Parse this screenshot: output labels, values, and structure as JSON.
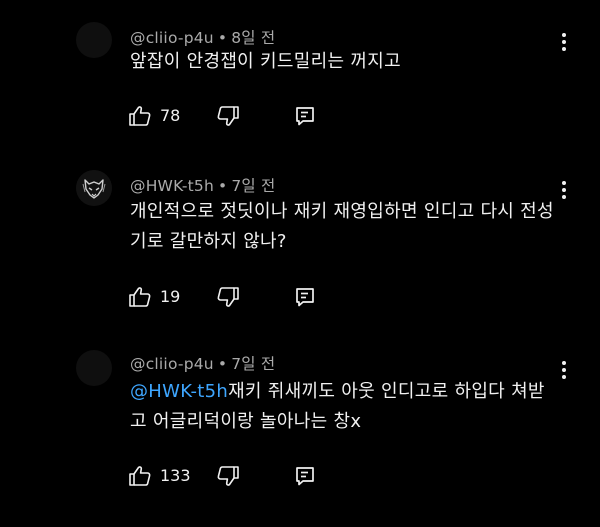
{
  "comments": [
    {
      "handle": "@cliio-p4u",
      "time": "8일 전",
      "text": "앞잡이 안경잽이 키드밀리는 꺼지고",
      "likes": "78",
      "avatar_icon": "blank-avatar"
    },
    {
      "handle": "@HWK-t5h",
      "time": "7일 전",
      "text": "개인적으로 젓딧이나 재키 재영입하면 인디고 다시 전성기로 갈만하지 않나?",
      "likes": "19",
      "avatar_icon": "wolf-logo-avatar"
    },
    {
      "handle": "@cliio-p4u",
      "time": "7일 전",
      "mention": "@HWK-t5h",
      "text": "재키 쥐새끼도 아웃 인디고로 하입다 쳐받고 어글리덕이랑 놀아나는 창x",
      "likes": "133",
      "avatar_icon": "blank-avatar"
    }
  ],
  "meta_separator": "•",
  "icons": {
    "like": "thumbs-up-icon",
    "dislike": "thumbs-down-icon",
    "reply": "reply-icon",
    "menu": "more-vert-icon"
  },
  "colors": {
    "background": "#000000",
    "text": "#f1f1f1",
    "meta": "#aaaaaa",
    "mention": "#3ea6ff"
  }
}
